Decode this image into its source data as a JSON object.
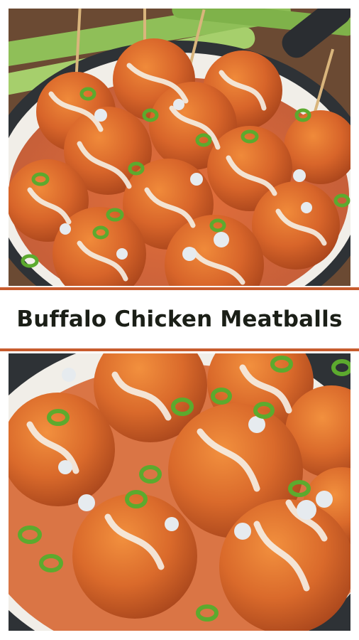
{
  "pin": {
    "title": "Buffalo Chicken Meatballs"
  },
  "images": {
    "top_photo": "overhead close-up of buffalo sauce glazed chicken meatballs with toothpicks, ranch drizzle, blue cheese crumbles and green onions in a cast iron skillet, celery sticks behind",
    "bottom_photo": "closer angled view of buffalo chicken meatballs with ranch drizzle, blue cheese crumbles and sliced green onions in a cast iron skillet"
  },
  "colors": {
    "accent_divider": "#c85c2e",
    "title_text": "#1b1f17",
    "sauce_orange": "#e0601f",
    "meatball_orange": "#d8702c",
    "green_onion": "#5caa2e",
    "skillet": "#2e3236",
    "celery": "#8fbf58",
    "table_wood": "#6b4a33"
  }
}
